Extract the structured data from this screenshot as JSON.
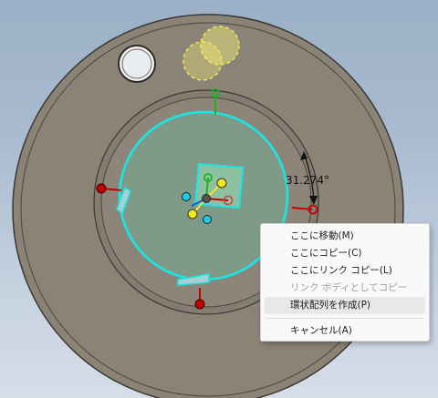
{
  "viewport": {
    "dimension_label": "31.274°",
    "colors": {
      "part_body": "#8b8376",
      "part_edge": "#3b3835",
      "selected_edge": "#19e6e6",
      "preview_sketch": "#f0ec70",
      "handle_red": "#c40000",
      "handle_green": "#19b31c",
      "handle_yellow": "#f5e61a",
      "handle_cyan": "#1ecbe8"
    }
  },
  "context_menu": {
    "items": [
      {
        "label": "ここに移動(M)",
        "enabled": true,
        "highlighted": false
      },
      {
        "label": "ここにコピー(C)",
        "enabled": true,
        "highlighted": false
      },
      {
        "label": "ここにリンク コピー(L)",
        "enabled": true,
        "highlighted": false
      },
      {
        "label": "リンク ボディとしてコピー",
        "enabled": false,
        "highlighted": false
      },
      {
        "label": "環状配列を作成(P)",
        "enabled": true,
        "highlighted": true
      },
      {
        "label": "キャンセル(A)",
        "enabled": true,
        "highlighted": false
      }
    ]
  }
}
